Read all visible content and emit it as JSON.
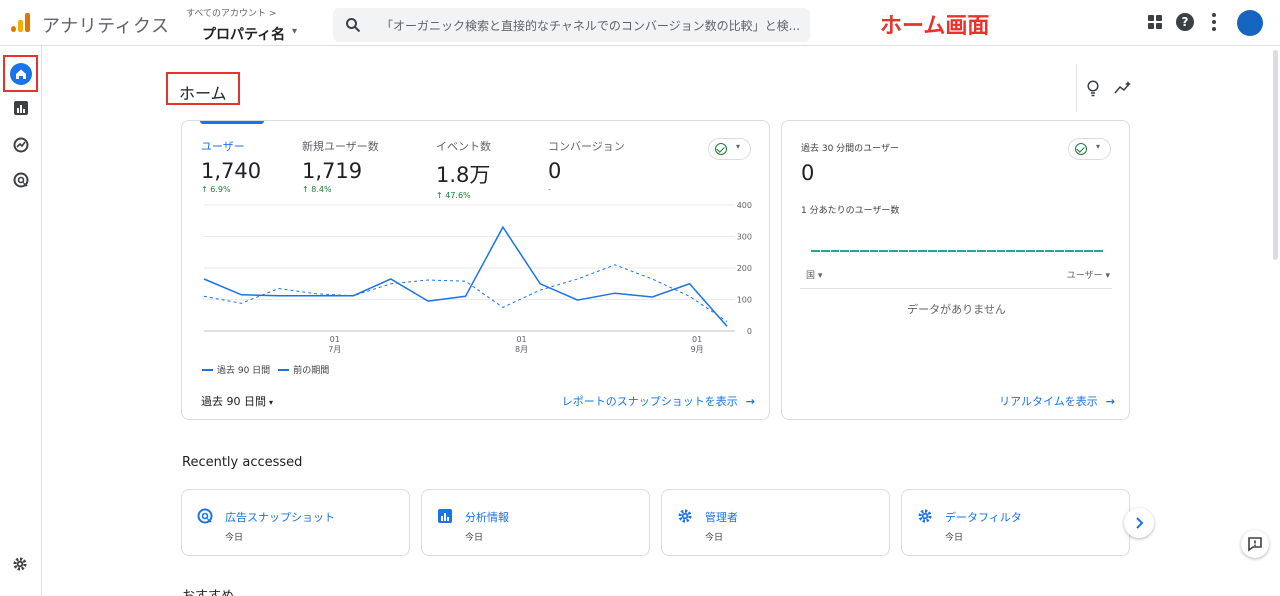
{
  "header": {
    "app_title": "アナリティクス",
    "account_crumb": "すべてのアカウント >",
    "property_name": "プロパティ名",
    "search_placeholder": "「オーガニック検索と直接的なチャネルでのコンバージョン数の比較」と検...",
    "screen_label": "ホーム画面",
    "help_glyph": "?"
  },
  "nav": {
    "items": [
      "home-icon",
      "reports-icon",
      "explore-icon",
      "advertising-icon"
    ],
    "settings": "gear-icon"
  },
  "page": {
    "title": "ホーム"
  },
  "summary_card": {
    "metrics": [
      {
        "label": "ユーザー",
        "value": "1,740",
        "delta": "↑ 6.9%",
        "active": true
      },
      {
        "label": "新規ユーザー数",
        "value": "1,719",
        "delta": "↑ 8.4%",
        "active": false
      },
      {
        "label": "イベント数",
        "value": "1.8万",
        "delta": "↑ 47.6%",
        "active": false
      },
      {
        "label": "コンバージョン",
        "value": "0",
        "delta": "-",
        "active": false
      }
    ],
    "legend_current": "過去 90 日間",
    "legend_previous": "前の期間",
    "date_range": "過去 90 日間",
    "snapshot_link": "レポートのスナップショットを表示",
    "arrow": "→",
    "caret": "▾"
  },
  "chart_data": {
    "type": "line",
    "x_tick_labels": [
      {
        "day": "01",
        "month": "7月"
      },
      {
        "day": "01",
        "month": "8月"
      },
      {
        "day": "01",
        "month": "9月"
      }
    ],
    "yticks": [
      "400",
      "300",
      "200",
      "100",
      "0"
    ],
    "ylim": [
      0,
      400
    ],
    "series": [
      {
        "name": "過去 90 日間",
        "style": "solid",
        "color": "#1a73e8",
        "values": [
          165,
          115,
          112,
          112,
          112,
          165,
          95,
          110,
          330,
          150,
          98,
          120,
          108,
          150,
          15
        ]
      },
      {
        "name": "前の期間",
        "style": "dashed",
        "color": "#1a73e8",
        "values": [
          110,
          88,
          135,
          118,
          112,
          150,
          162,
          158,
          75,
          130,
          165,
          210,
          165,
          110,
          30
        ]
      }
    ]
  },
  "realtime_card": {
    "label": "過去 30 分間のユーザー",
    "value": "0",
    "sub_label": "1 分あたりのユーザー数",
    "col_left": "国 ▾",
    "col_right": "ユーザー ▾",
    "empty_text": "データがありません",
    "link": "リアルタイムを表示",
    "arrow": "→"
  },
  "recent": {
    "title": "Recently accessed",
    "items": [
      {
        "name": "広告スナップショット",
        "date": "今日",
        "icon": "advertising-icon"
      },
      {
        "name": "分析情報",
        "date": "今日",
        "icon": "insights-icon"
      },
      {
        "name": "管理者",
        "date": "今日",
        "icon": "admin-gear-icon"
      },
      {
        "name": "データフィルタ",
        "date": "今日",
        "icon": "filter-gear-icon"
      }
    ],
    "next_icon": "chevron-right-icon"
  },
  "recommended": {
    "title": "おすすめ"
  },
  "colors": {
    "accent": "#1a73e8",
    "positive": "#188038",
    "annotation": "#e8322b",
    "avatar": "#1565c0"
  }
}
